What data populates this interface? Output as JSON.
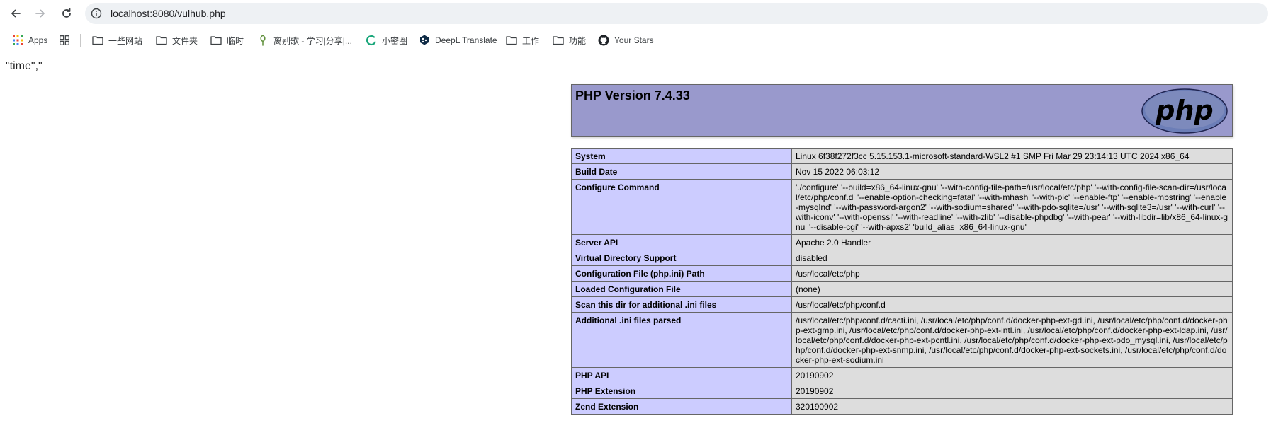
{
  "browser": {
    "url": "localhost:8080/vulhub.php",
    "bookmarks": [
      {
        "label": "Apps",
        "icon": "apps-grid-icon"
      },
      {
        "label": "",
        "icon": "tab-groups-icon"
      },
      {
        "label": "一些网站",
        "icon": "folder-icon"
      },
      {
        "label": "文件夹",
        "icon": "folder-icon"
      },
      {
        "label": "临时",
        "icon": "folder-icon"
      },
      {
        "label": "离别歌 - 学习|分享|...",
        "icon": "leaf-icon"
      },
      {
        "label": "小密圈",
        "icon": "circle-logo-icon"
      },
      {
        "label": "DeepL Translate",
        "icon": "deepl-icon"
      },
      {
        "label": "工作",
        "icon": "folder-icon"
      },
      {
        "label": "功能",
        "icon": "folder-icon"
      },
      {
        "label": "Your Stars",
        "icon": "github-icon"
      }
    ]
  },
  "page": {
    "output_text": "\"time\",\"",
    "php_version": "PHP Version 7.4.33",
    "rows": [
      {
        "key": "System",
        "value": "Linux 6f38f272f3cc 5.15.153.1-microsoft-standard-WSL2 #1 SMP Fri Mar 29 23:14:13 UTC 2024 x86_64"
      },
      {
        "key": "Build Date",
        "value": "Nov 15 2022 06:03:12"
      },
      {
        "key": "Configure Command",
        "value": "'./configure' '--build=x86_64-linux-gnu' '--with-config-file-path=/usr/local/etc/php' '--with-config-file-scan-dir=/usr/local/etc/php/conf.d' '--enable-option-checking=fatal' '--with-mhash' '--with-pic' '--enable-ftp' '--enable-mbstring' '--enable-mysqlnd' '--with-password-argon2' '--with-sodium=shared' '--with-pdo-sqlite=/usr' '--with-sqlite3=/usr' '--with-curl' '--with-iconv' '--with-openssl' '--with-readline' '--with-zlib' '--disable-phpdbg' '--with-pear' '--with-libdir=lib/x86_64-linux-gnu' '--disable-cgi' '--with-apxs2' 'build_alias=x86_64-linux-gnu'"
      },
      {
        "key": "Server API",
        "value": "Apache 2.0 Handler"
      },
      {
        "key": "Virtual Directory Support",
        "value": "disabled"
      },
      {
        "key": "Configuration File (php.ini) Path",
        "value": "/usr/local/etc/php"
      },
      {
        "key": "Loaded Configuration File",
        "value": "(none)"
      },
      {
        "key": "Scan this dir for additional .ini files",
        "value": "/usr/local/etc/php/conf.d"
      },
      {
        "key": "Additional .ini files parsed",
        "value": "/usr/local/etc/php/conf.d/cacti.ini, /usr/local/etc/php/conf.d/docker-php-ext-gd.ini, /usr/local/etc/php/conf.d/docker-php-ext-gmp.ini, /usr/local/etc/php/conf.d/docker-php-ext-intl.ini, /usr/local/etc/php/conf.d/docker-php-ext-ldap.ini, /usr/local/etc/php/conf.d/docker-php-ext-pcntl.ini, /usr/local/etc/php/conf.d/docker-php-ext-pdo_mysql.ini, /usr/local/etc/php/conf.d/docker-php-ext-snmp.ini, /usr/local/etc/php/conf.d/docker-php-ext-sockets.ini, /usr/local/etc/php/conf.d/docker-php-ext-sodium.ini"
      },
      {
        "key": "PHP API",
        "value": "20190902"
      },
      {
        "key": "PHP Extension",
        "value": "20190902"
      },
      {
        "key": "Zend Extension",
        "value": "320190902"
      }
    ]
  },
  "colors": {
    "header_bg": "#9999cc",
    "key_bg": "#ccccff",
    "value_bg": "#dddddd"
  }
}
